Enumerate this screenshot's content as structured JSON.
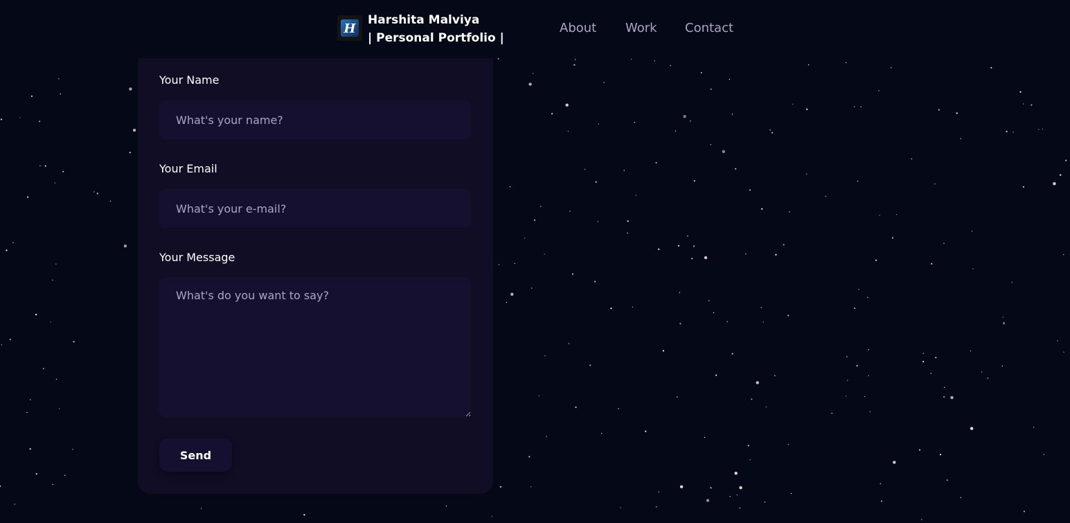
{
  "brand": {
    "logo_icon": "h-logo-icon",
    "name_line1": "Harshita Malviya",
    "name_line2": "| Personal Portfolio |"
  },
  "nav": {
    "items": [
      {
        "label": "About"
      },
      {
        "label": "Work"
      },
      {
        "label": "Contact"
      }
    ]
  },
  "form": {
    "name_label": "Your Name",
    "name_placeholder": "What's your name?",
    "email_label": "Your Email",
    "email_placeholder": "What's your e-mail?",
    "message_label": "Your Message",
    "message_placeholder": "What's do you want to say?",
    "send_label": "Send"
  },
  "colors": {
    "background": "#050816",
    "card": "#100d25",
    "input": "#151030",
    "secondary_text": "#aaa6c3"
  }
}
